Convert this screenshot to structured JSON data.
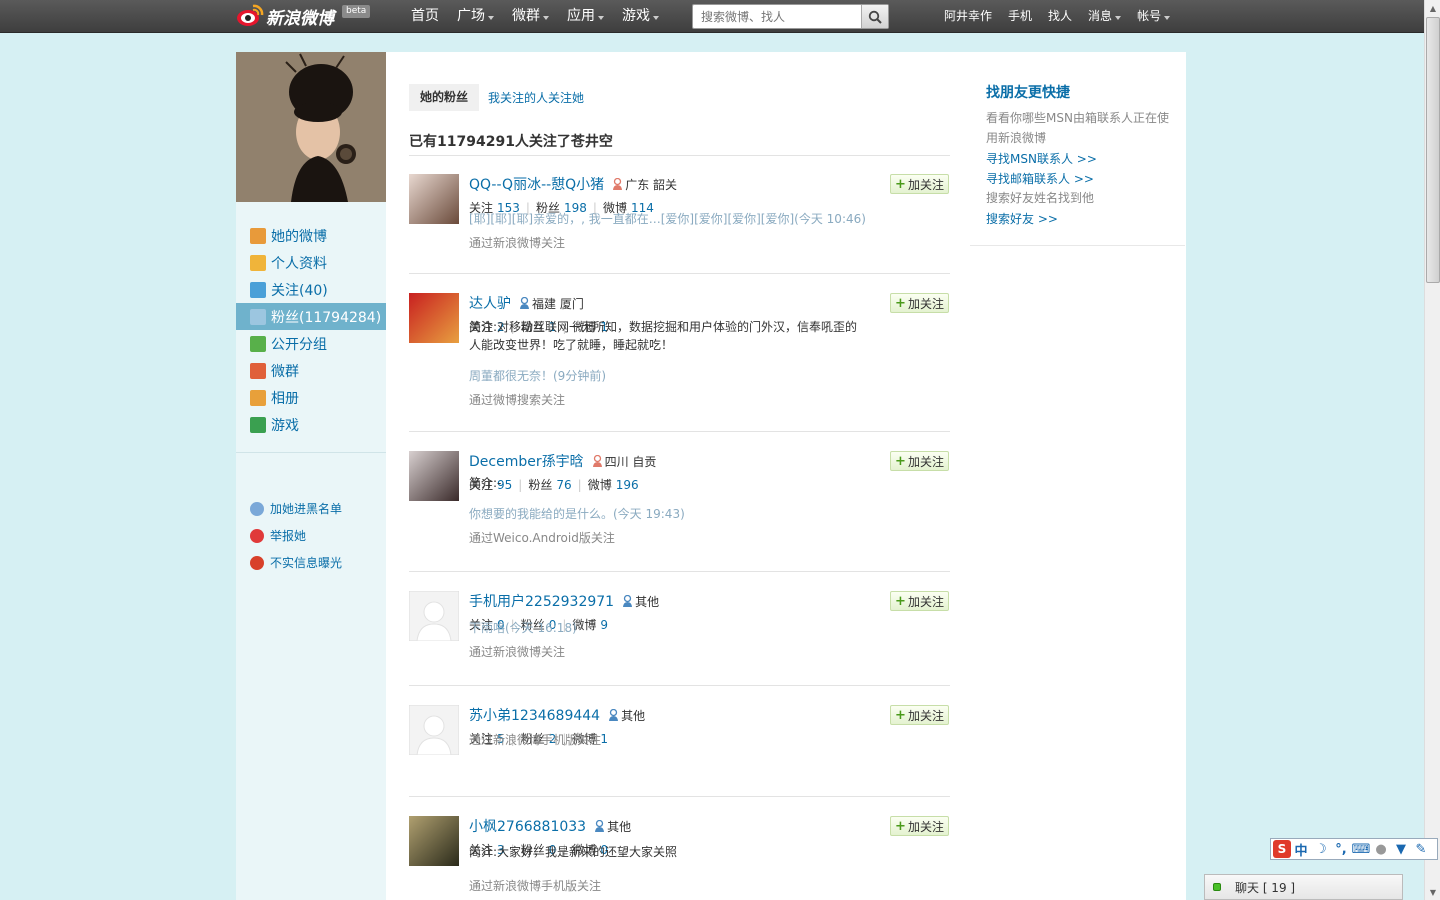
{
  "topbar": {
    "logo_text": "新浪微博",
    "beta": "beta",
    "nav": [
      "首页",
      "广场",
      "微群",
      "应用",
      "游戏"
    ],
    "nav_dropdown": [
      false,
      true,
      true,
      true,
      true
    ],
    "search_placeholder": "搜索微博、找人",
    "right_nav": [
      "阿井幸作",
      "手机",
      "找人",
      "消息",
      "帐号"
    ],
    "right_dropdown": [
      false,
      false,
      false,
      true,
      true
    ]
  },
  "sidebar": {
    "items": [
      {
        "label": "她的微博",
        "icon": "home-icon",
        "color": "#e89a3a"
      },
      {
        "label": "个人资料",
        "icon": "profile-card-icon",
        "color": "#f0b43a"
      },
      {
        "label": "关注(40)",
        "icon": "user-follow-icon",
        "color": "#4aa0d8"
      },
      {
        "label": "粉丝(11794284)",
        "icon": "fans-icon",
        "color": "#9cc6e0",
        "active": true
      },
      {
        "label": "公开分组",
        "icon": "group-icon",
        "color": "#58b04a"
      },
      {
        "label": "微群",
        "icon": "weiqun-icon",
        "color": "#e0603a"
      },
      {
        "label": "相册",
        "icon": "photo-album-icon",
        "color": "#e8a03a"
      },
      {
        "label": "游戏",
        "icon": "game-icon",
        "color": "#3aa050"
      }
    ],
    "actions": [
      {
        "label": "加她进黑名单",
        "icon": "blacklist-icon",
        "color": "#7aa8d8"
      },
      {
        "label": "举报她",
        "icon": "report-icon",
        "color": "#e03a3a"
      },
      {
        "label": "不实信息曝光",
        "icon": "expose-icon",
        "color": "#d8402a"
      }
    ]
  },
  "main": {
    "tab_active": "她的粉丝",
    "tab_link": "我关注的人关注她",
    "count_title": "已有11794291人关注了苍井空",
    "follow_label": "加关注",
    "labels": {
      "follow": "关注",
      "fans": "粉丝",
      "weibo": "微博"
    },
    "fans": [
      {
        "name": "QQ--Q丽冰--憇Q小猪",
        "gender": "female",
        "location": "广东 韶关",
        "follow": "153",
        "fans_count": "198",
        "weibo": "114",
        "intro": "",
        "post": "[耶][耶][耶]亲爱的，, 我一直都在…[爱你][爱你][爱你][爱你](今天 10:46)",
        "via": "通过新浪微博关注",
        "avatar_colors": [
          "#e8d8d0",
          "#6a4a3a"
        ]
      },
      {
        "name": "达人驴",
        "gender": "male",
        "location": "福建 厦门",
        "follow": "2",
        "fans_count": "1",
        "weibo": "1",
        "intro": "简介:对移动互联网一无所知，数据挖掘和用户体验的门外汉，信奉吼歪的人能改变世界！吃了就睡，睡起就吃！",
        "post": "周董都很无奈！(9分钟前)",
        "via": "通过微博搜索关注",
        "avatar_colors": [
          "#c82020",
          "#e8a040"
        ]
      },
      {
        "name": "December孫宇晗",
        "gender": "female",
        "location": "四川 自贡",
        "follow": "95",
        "fans_count": "76",
        "weibo": "196",
        "intro": "简介:-",
        "post": "你想要的我能给的是什么。(今天 19:43)",
        "via": "通过Weico.Android版关注",
        "avatar_colors": [
          "#d8d0d0",
          "#3a2a2a"
        ]
      },
      {
        "name": "手机用户2252932971",
        "gender": "male",
        "location": "其他",
        "follow": "0",
        "fans_count": "0",
        "weibo": "9",
        "intro": "",
        "post": "下雨咯(今天 16:18)",
        "via": "通过新浪微博关注",
        "avatar_colors": [
          "#eeeeee",
          "#d0d0d0"
        ]
      },
      {
        "name": "苏小弟1234689444",
        "gender": "male",
        "location": "其他",
        "follow": "5",
        "fans_count": "2",
        "weibo": "1",
        "intro": "",
        "post": "",
        "via": "通过新浪微博手机版关注",
        "avatar_colors": [
          "#eeeeee",
          "#d0d0d0"
        ]
      },
      {
        "name": "小枫2766881033",
        "gender": "male",
        "location": "其他",
        "follow": "3",
        "fans_count": "0",
        "weibo": "0",
        "intro": "简介:大家好，我是新来的还望大家关照",
        "post": "",
        "via": "通过新浪微博手机版关注",
        "avatar_colors": [
          "#b0a070",
          "#2a2a1a"
        ]
      }
    ]
  },
  "right": {
    "title": "找朋友更快捷",
    "text1": "看看你哪些MSN由箱联系人正在使用新浪微博",
    "link1": "寻找MSN联系人 >>",
    "link2": "寻找邮箱联系人 >>",
    "text2": "搜索好友姓名找到他",
    "link3": "搜索好友 >>"
  },
  "ime": {
    "zh": "中"
  },
  "chat": {
    "label": "聊天 [ 19 ]"
  }
}
